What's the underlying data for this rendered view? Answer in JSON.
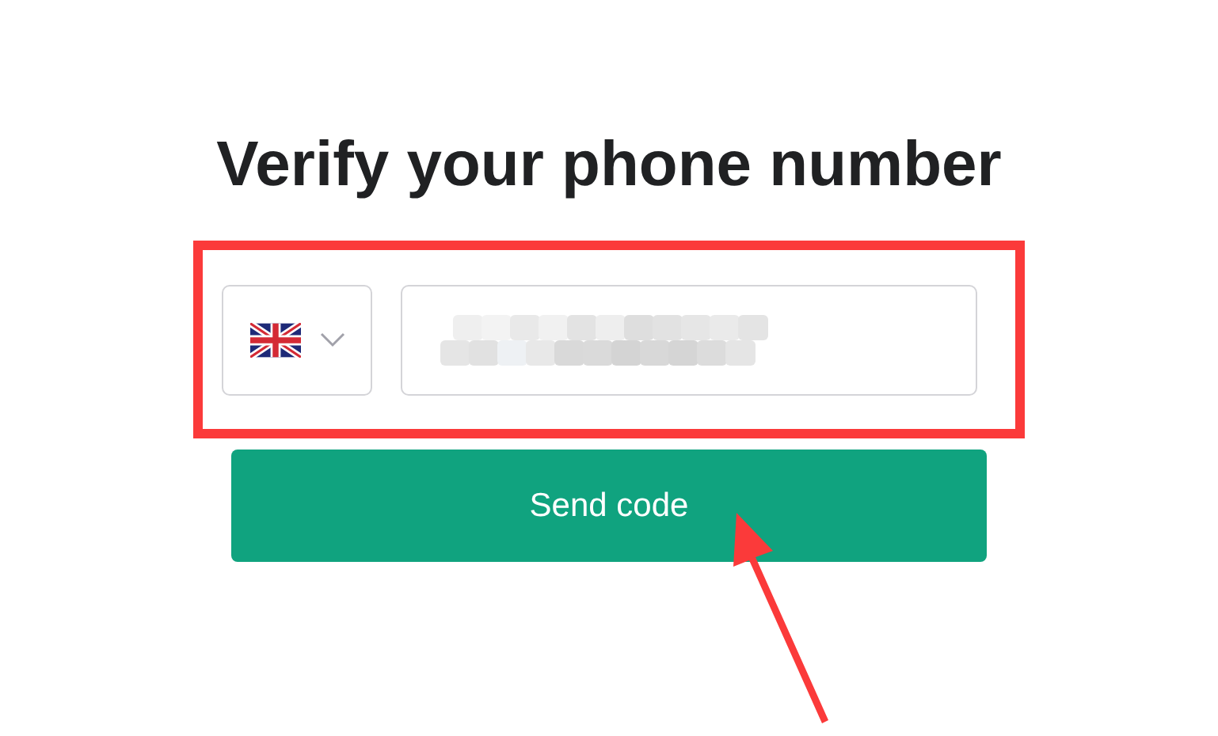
{
  "heading": "Verify your phone number",
  "phone_form": {
    "country_select": {
      "expanded": false
    }
  },
  "send_button": {
    "label": "Send code"
  }
}
